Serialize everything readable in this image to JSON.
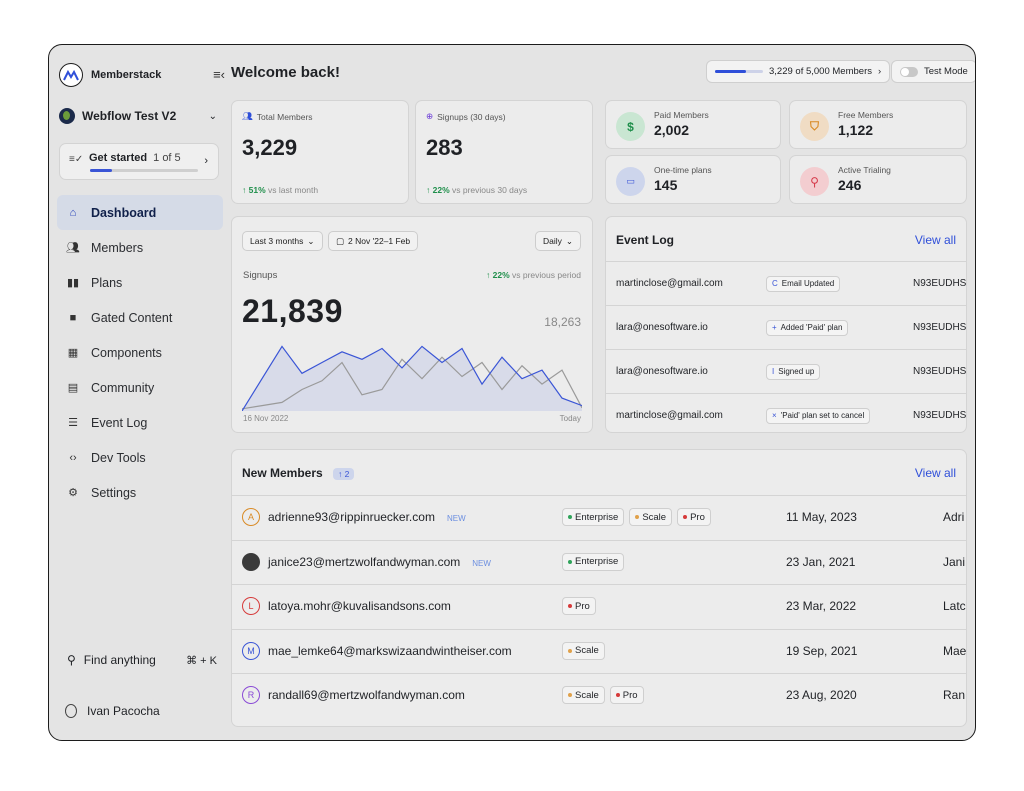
{
  "sidebar": {
    "brand": "Memberstack",
    "workspace": "Webflow Test V2",
    "get_started": {
      "label": "Get started",
      "count": "1 of 5",
      "progress": 0.2
    },
    "items": [
      {
        "label": "Dashboard",
        "icon": "home-icon",
        "active": true
      },
      {
        "label": "Members",
        "icon": "users-icon"
      },
      {
        "label": "Plans",
        "icon": "plans-icon"
      },
      {
        "label": "Gated Content",
        "icon": "folder-icon"
      },
      {
        "label": "Components",
        "icon": "grid-icon"
      },
      {
        "label": "Community",
        "icon": "chat-icon"
      },
      {
        "label": "Event Log",
        "icon": "list-icon"
      },
      {
        "label": "Dev Tools",
        "icon": "code-icon"
      },
      {
        "label": "Settings",
        "icon": "gear-icon"
      }
    ],
    "find": {
      "label": "Find anything",
      "shortcut": "⌘ + K"
    },
    "user": "Ivan Pacocha"
  },
  "header": {
    "title": "Welcome back!",
    "members_usage": "3,229 of 5,000 Members",
    "members_progress": 0.65,
    "test_mode": "Test Mode"
  },
  "stats": {
    "total": {
      "label": "Total Members",
      "value": "3,229",
      "delta": "51%",
      "delta_text": "vs last month"
    },
    "signups": {
      "label": "Signups (30 days)",
      "value": "283",
      "delta": "22%",
      "delta_text": "vs previous 30 days"
    }
  },
  "mini_stats": {
    "paid": {
      "label": "Paid Members",
      "value": "2,002",
      "icon": "$"
    },
    "free": {
      "label": "Free Members",
      "value": "1,122",
      "icon": "shield-icon"
    },
    "one_time": {
      "label": "One-time plans",
      "value": "145",
      "icon": "card-icon"
    },
    "trialing": {
      "label": "Active Trialing",
      "value": "246",
      "icon": "search-icon"
    }
  },
  "signups_chart": {
    "range_button": "Last 3 months",
    "date_button": "2 Nov '22–1 Feb",
    "interval_button": "Daily",
    "label": "Signups",
    "delta": "22%",
    "delta_text": "vs previous period",
    "total": "21,839",
    "previous_total": "18,263",
    "x_start": "16 Nov 2022",
    "x_end": "Today"
  },
  "chart_data": {
    "type": "area",
    "title": "Signups",
    "xlabel": "",
    "ylabel": "",
    "series": [
      {
        "values": [
          0,
          30,
          60,
          35,
          45,
          55,
          48,
          58,
          40,
          60,
          45,
          58,
          25,
          50,
          30,
          38,
          12,
          5
        ]
      },
      {
        "values": [
          2,
          5,
          8,
          20,
          28,
          45,
          15,
          20,
          48,
          30,
          50,
          32,
          45,
          20,
          42,
          25,
          38,
          3
        ]
      }
    ],
    "x_range": [
      "16 Nov 2022",
      "Today"
    ],
    "grid": false
  },
  "event_log": {
    "title": "Event Log",
    "view_all": "View all",
    "rows": [
      {
        "email": "martinclose@gmail.com",
        "event": "Email Updated",
        "icon": "C",
        "id": "N93EUDHS"
      },
      {
        "email": "lara@onesoftware.io",
        "event": "Added 'Paid' plan",
        "icon": "+",
        "id": "N93EUDHS"
      },
      {
        "email": "lara@onesoftware.io",
        "event": "Signed up",
        "icon": "I",
        "id": "N93EUDHS"
      },
      {
        "email": "martinclose@gmail.com",
        "event": "'Paid' plan set to cancel",
        "icon": "×",
        "id": "N93EUDHS"
      }
    ]
  },
  "new_members": {
    "title": "New Members",
    "badge": "↑ 2",
    "view_all": "View all",
    "rows": [
      {
        "initial": "A",
        "email": "adrienne93@rippinruecker.com",
        "new": "NEW",
        "plans": [
          "Enterprise",
          "Scale",
          "Pro"
        ],
        "date": "11 May, 2023",
        "name": "Adri"
      },
      {
        "initial": "",
        "email": "janice23@mertzwolfandwyman.com",
        "new": "NEW",
        "plans": [
          "Enterprise"
        ],
        "date": "23 Jan, 2021",
        "name": "Jani"
      },
      {
        "initial": "L",
        "email": "latoya.mohr@kuvalisandsons.com",
        "new": "",
        "plans": [
          "Pro"
        ],
        "date": "23 Mar, 2022",
        "name": "Latc"
      },
      {
        "initial": "M",
        "email": "mae_lemke64@markswizaandwintheiser.com",
        "new": "",
        "plans": [
          "Scale"
        ],
        "date": "19 Sep, 2021",
        "name": "Mae"
      },
      {
        "initial": "R",
        "email": "randall69@mertzwolfandwyman.com",
        "new": "",
        "plans": [
          "Scale",
          "Pro"
        ],
        "date": "23 Aug, 2020",
        "name": "Ran"
      }
    ]
  },
  "colors": {
    "accent": "#2f4fd9",
    "up": "#1f8f4b",
    "enterprise": "#2fa35a",
    "scale": "#e0a14a",
    "pro": "#d63a3a"
  }
}
